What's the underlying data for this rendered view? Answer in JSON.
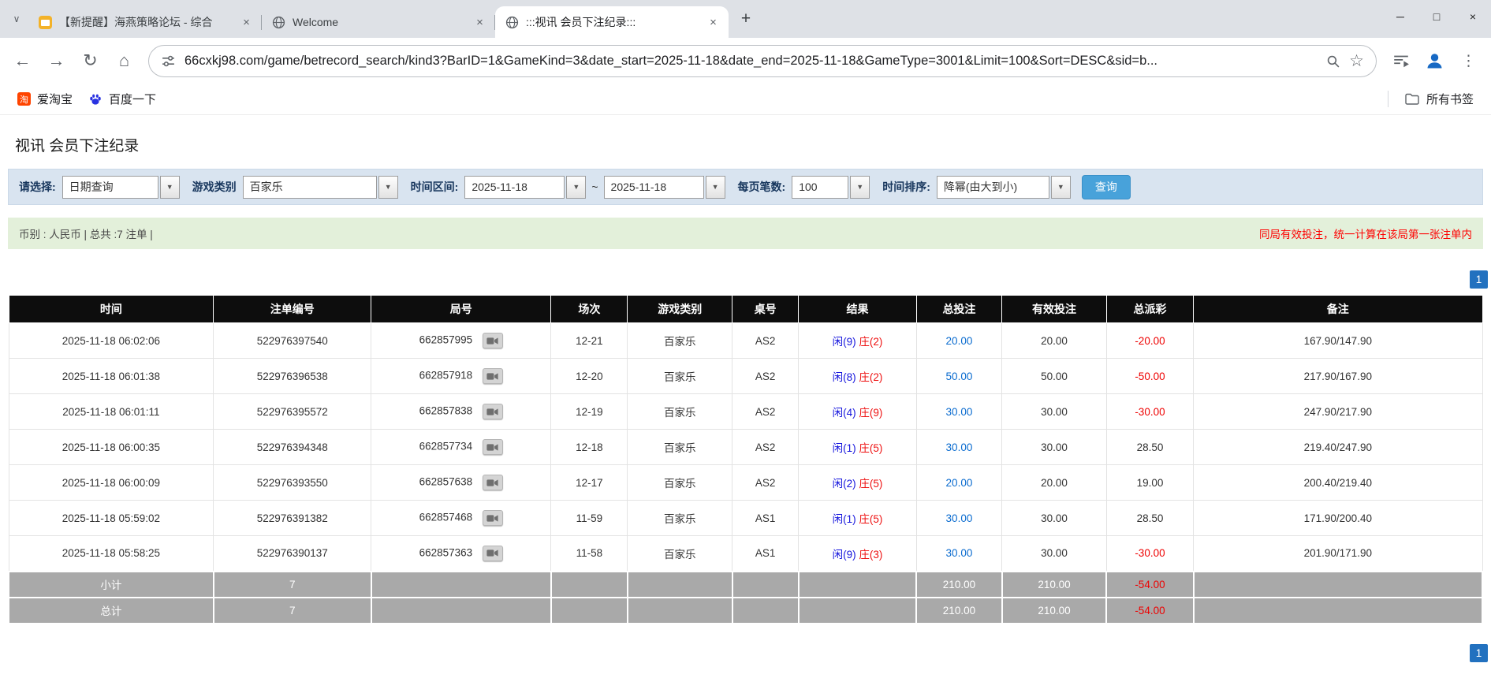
{
  "browser": {
    "tabs": [
      {
        "title": "【新提醒】海燕策略论坛 - 综合",
        "active": false
      },
      {
        "title": "Welcome",
        "active": false
      },
      {
        "title": ":::视讯 会员下注纪录:::",
        "active": true
      }
    ],
    "icons": {
      "tab_search": "∨",
      "tab_close": "×",
      "new_tab": "+",
      "minimize": "─",
      "maximize": "□",
      "close": "×",
      "back": "←",
      "forward": "→",
      "reload": "↻",
      "home": "⌂",
      "star": "☆",
      "menu": "⋮",
      "taobao_glyph": "淘"
    },
    "address": {
      "url": "66cxkj98.com/game/betrecord_search/kind3?BarID=1&GameKind=3&date_start=2025-11-18&date_end=2025-11-18&GameType=3001&Limit=100&Sort=DESC&sid=b..."
    },
    "bookmarks_bar": {
      "items": [
        {
          "label": "爱淘宝"
        },
        {
          "label": "百度一下"
        }
      ],
      "all_bookmarks": "所有书签"
    }
  },
  "page": {
    "title": "视讯 会员下注纪录",
    "filter": {
      "select_label": "请选择:",
      "select_value": "日期查询",
      "game_type_label": "游戏类别",
      "game_type_value": "百家乐",
      "date_range_label": "时间区间:",
      "date_start": "2025-11-18",
      "date_separator": "~",
      "date_end": "2025-11-18",
      "per_page_label": "每页笔数:",
      "per_page_value": "100",
      "sort_label": "时间排序:",
      "sort_value": "降幂(由大到小)",
      "search_button": "查询",
      "arrow_glyph": "▼"
    },
    "info": {
      "summary": "币别 : 人民币 | 总共 :7 注单 |",
      "notice": "同局有效投注，统一计算在该局第一张注单内"
    },
    "pagination": {
      "page_label": "1"
    },
    "table": {
      "headers": [
        "时间",
        "注单编号",
        "局号",
        "场次",
        "游戏类别",
        "桌号",
        "结果",
        "总投注",
        "有效投注",
        "总派彩",
        "备注"
      ],
      "rows": [
        {
          "time": "2025-11-18 06:02:06",
          "bet_id": "522976397540",
          "round": "662857995",
          "session": "12-21",
          "game": "百家乐",
          "table_no": "AS2",
          "result_player": "闲(9)",
          "result_banker": "庄(2)",
          "total_bet": "20.00",
          "valid_bet": "20.00",
          "payout": "-20.00",
          "note": "167.90/147.90"
        },
        {
          "time": "2025-11-18 06:01:38",
          "bet_id": "522976396538",
          "round": "662857918",
          "session": "12-20",
          "game": "百家乐",
          "table_no": "AS2",
          "result_player": "闲(8)",
          "result_banker": "庄(2)",
          "total_bet": "50.00",
          "valid_bet": "50.00",
          "payout": "-50.00",
          "note": "217.90/167.90"
        },
        {
          "time": "2025-11-18 06:01:11",
          "bet_id": "522976395572",
          "round": "662857838",
          "session": "12-19",
          "game": "百家乐",
          "table_no": "AS2",
          "result_player": "闲(4)",
          "result_banker": "庄(9)",
          "total_bet": "30.00",
          "valid_bet": "30.00",
          "payout": "-30.00",
          "note": "247.90/217.90"
        },
        {
          "time": "2025-11-18 06:00:35",
          "bet_id": "522976394348",
          "round": "662857734",
          "session": "12-18",
          "game": "百家乐",
          "table_no": "AS2",
          "result_player": "闲(1)",
          "result_banker": "庄(5)",
          "total_bet": "30.00",
          "valid_bet": "30.00",
          "payout": "28.50",
          "note": "219.40/247.90"
        },
        {
          "time": "2025-11-18 06:00:09",
          "bet_id": "522976393550",
          "round": "662857638",
          "session": "12-17",
          "game": "百家乐",
          "table_no": "AS2",
          "result_player": "闲(2)",
          "result_banker": "庄(5)",
          "total_bet": "20.00",
          "valid_bet": "20.00",
          "payout": "19.00",
          "note": "200.40/219.40"
        },
        {
          "time": "2025-11-18 05:59:02",
          "bet_id": "522976391382",
          "round": "662857468",
          "session": "11-59",
          "game": "百家乐",
          "table_no": "AS1",
          "result_player": "闲(1)",
          "result_banker": "庄(5)",
          "total_bet": "30.00",
          "valid_bet": "30.00",
          "payout": "28.50",
          "note": "171.90/200.40"
        },
        {
          "time": "2025-11-18 05:58:25",
          "bet_id": "522976390137",
          "round": "662857363",
          "session": "11-58",
          "game": "百家乐",
          "table_no": "AS1",
          "result_player": "闲(9)",
          "result_banker": "庄(3)",
          "total_bet": "30.00",
          "valid_bet": "30.00",
          "payout": "-30.00",
          "note": "201.90/171.90"
        }
      ],
      "subtotal": {
        "label": "小计",
        "count": "7",
        "total_bet": "210.00",
        "valid_bet": "210.00",
        "payout": "-54.00"
      },
      "total": {
        "label": "总计",
        "count": "7",
        "total_bet": "210.00",
        "valid_bet": "210.00",
        "payout": "-54.00"
      }
    }
  }
}
